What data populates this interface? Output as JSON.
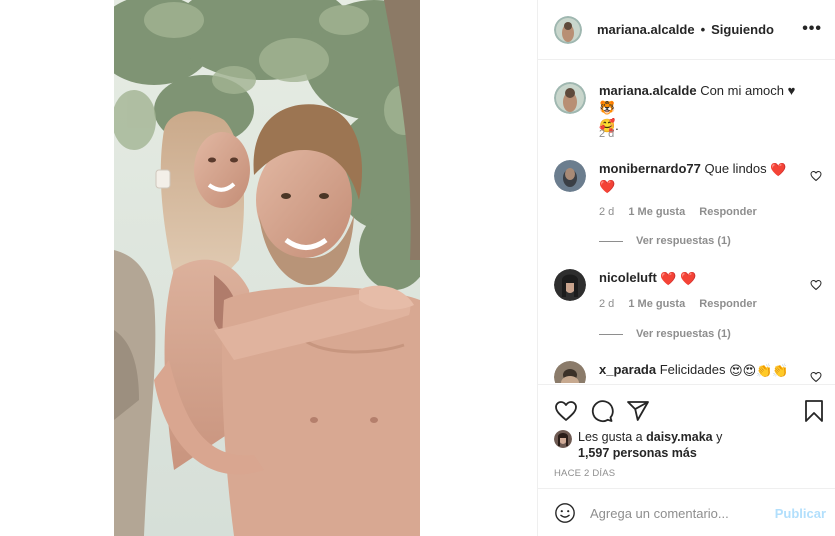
{
  "post": {
    "author": "mariana.alcalde",
    "separator": "•",
    "follow_state": "Siguiendo",
    "more_label": "•••"
  },
  "caption": {
    "username": "mariana.alcalde",
    "text": "Con mi amoch ♥🐯",
    "emoji_tail": "🥰.",
    "time": "2 d"
  },
  "comments": [
    {
      "username": "monibernardo77",
      "text": "Que lindos",
      "emoji": "❤️",
      "emoji2": "❤️",
      "time": "2 d",
      "likes": "1 Me gusta",
      "reply": "Responder",
      "view_replies": "Ver respuestas (1)"
    },
    {
      "username": "nicoleluft",
      "text": "",
      "emoji": "❤️ ❤️",
      "time": "2 d",
      "likes": "1 Me gusta",
      "reply": "Responder",
      "view_replies": "Ver respuestas (1)"
    },
    {
      "username": "x_parada",
      "text": "Felicidades",
      "emoji": "😍😍👏👏"
    }
  ],
  "likes": {
    "prefix": "Les gusta a",
    "user": "daisy.maka",
    "joiner": "y",
    "count_text": "1,597 personas más"
  },
  "posted_date": "HACE 2 DÍAS",
  "add_comment": {
    "placeholder": "Agrega un comentario...",
    "publish": "Publicar"
  },
  "colors": {
    "heart_red": "#ed4956",
    "text": "#262626",
    "muted": "#8e8e8e",
    "publish_disabled": "#b2dffc",
    "border": "#efefef"
  }
}
